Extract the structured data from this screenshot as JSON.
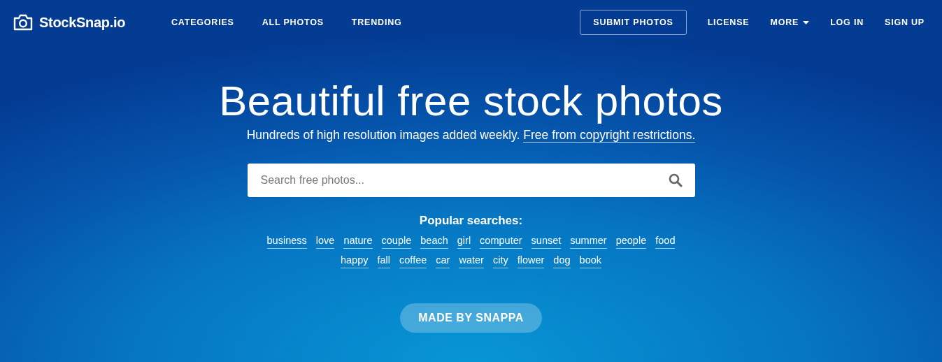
{
  "header": {
    "logo": "StockSnap.io",
    "nav_left": [
      "CATEGORIES",
      "ALL PHOTOS",
      "TRENDING"
    ],
    "nav_right": [
      {
        "label": "SUBMIT PHOTOS",
        "kind": "outlined"
      },
      {
        "label": "LICENSE",
        "kind": "link"
      },
      {
        "label": "MORE",
        "kind": "dropdown"
      },
      {
        "label": "LOG IN",
        "kind": "link"
      },
      {
        "label": "SIGN UP",
        "kind": "link"
      }
    ]
  },
  "hero": {
    "title": "Beautiful free stock photos",
    "subtitle": "Hundreds of high resolution images added weekly.",
    "subtitle_link": "Free from copyright restrictions."
  },
  "search": {
    "placeholder": "Search free photos..."
  },
  "popular_searches": {
    "title": "Popular searches:",
    "tags": [
      "business",
      "love",
      "nature",
      "couple",
      "beach",
      "girl",
      "computer",
      "sunset",
      "summer",
      "people",
      "food",
      "happy",
      "fall",
      "coffee",
      "car",
      "water",
      "city",
      "flower",
      "dog",
      "book"
    ]
  },
  "made_by": "MADE BY SNAPPA"
}
